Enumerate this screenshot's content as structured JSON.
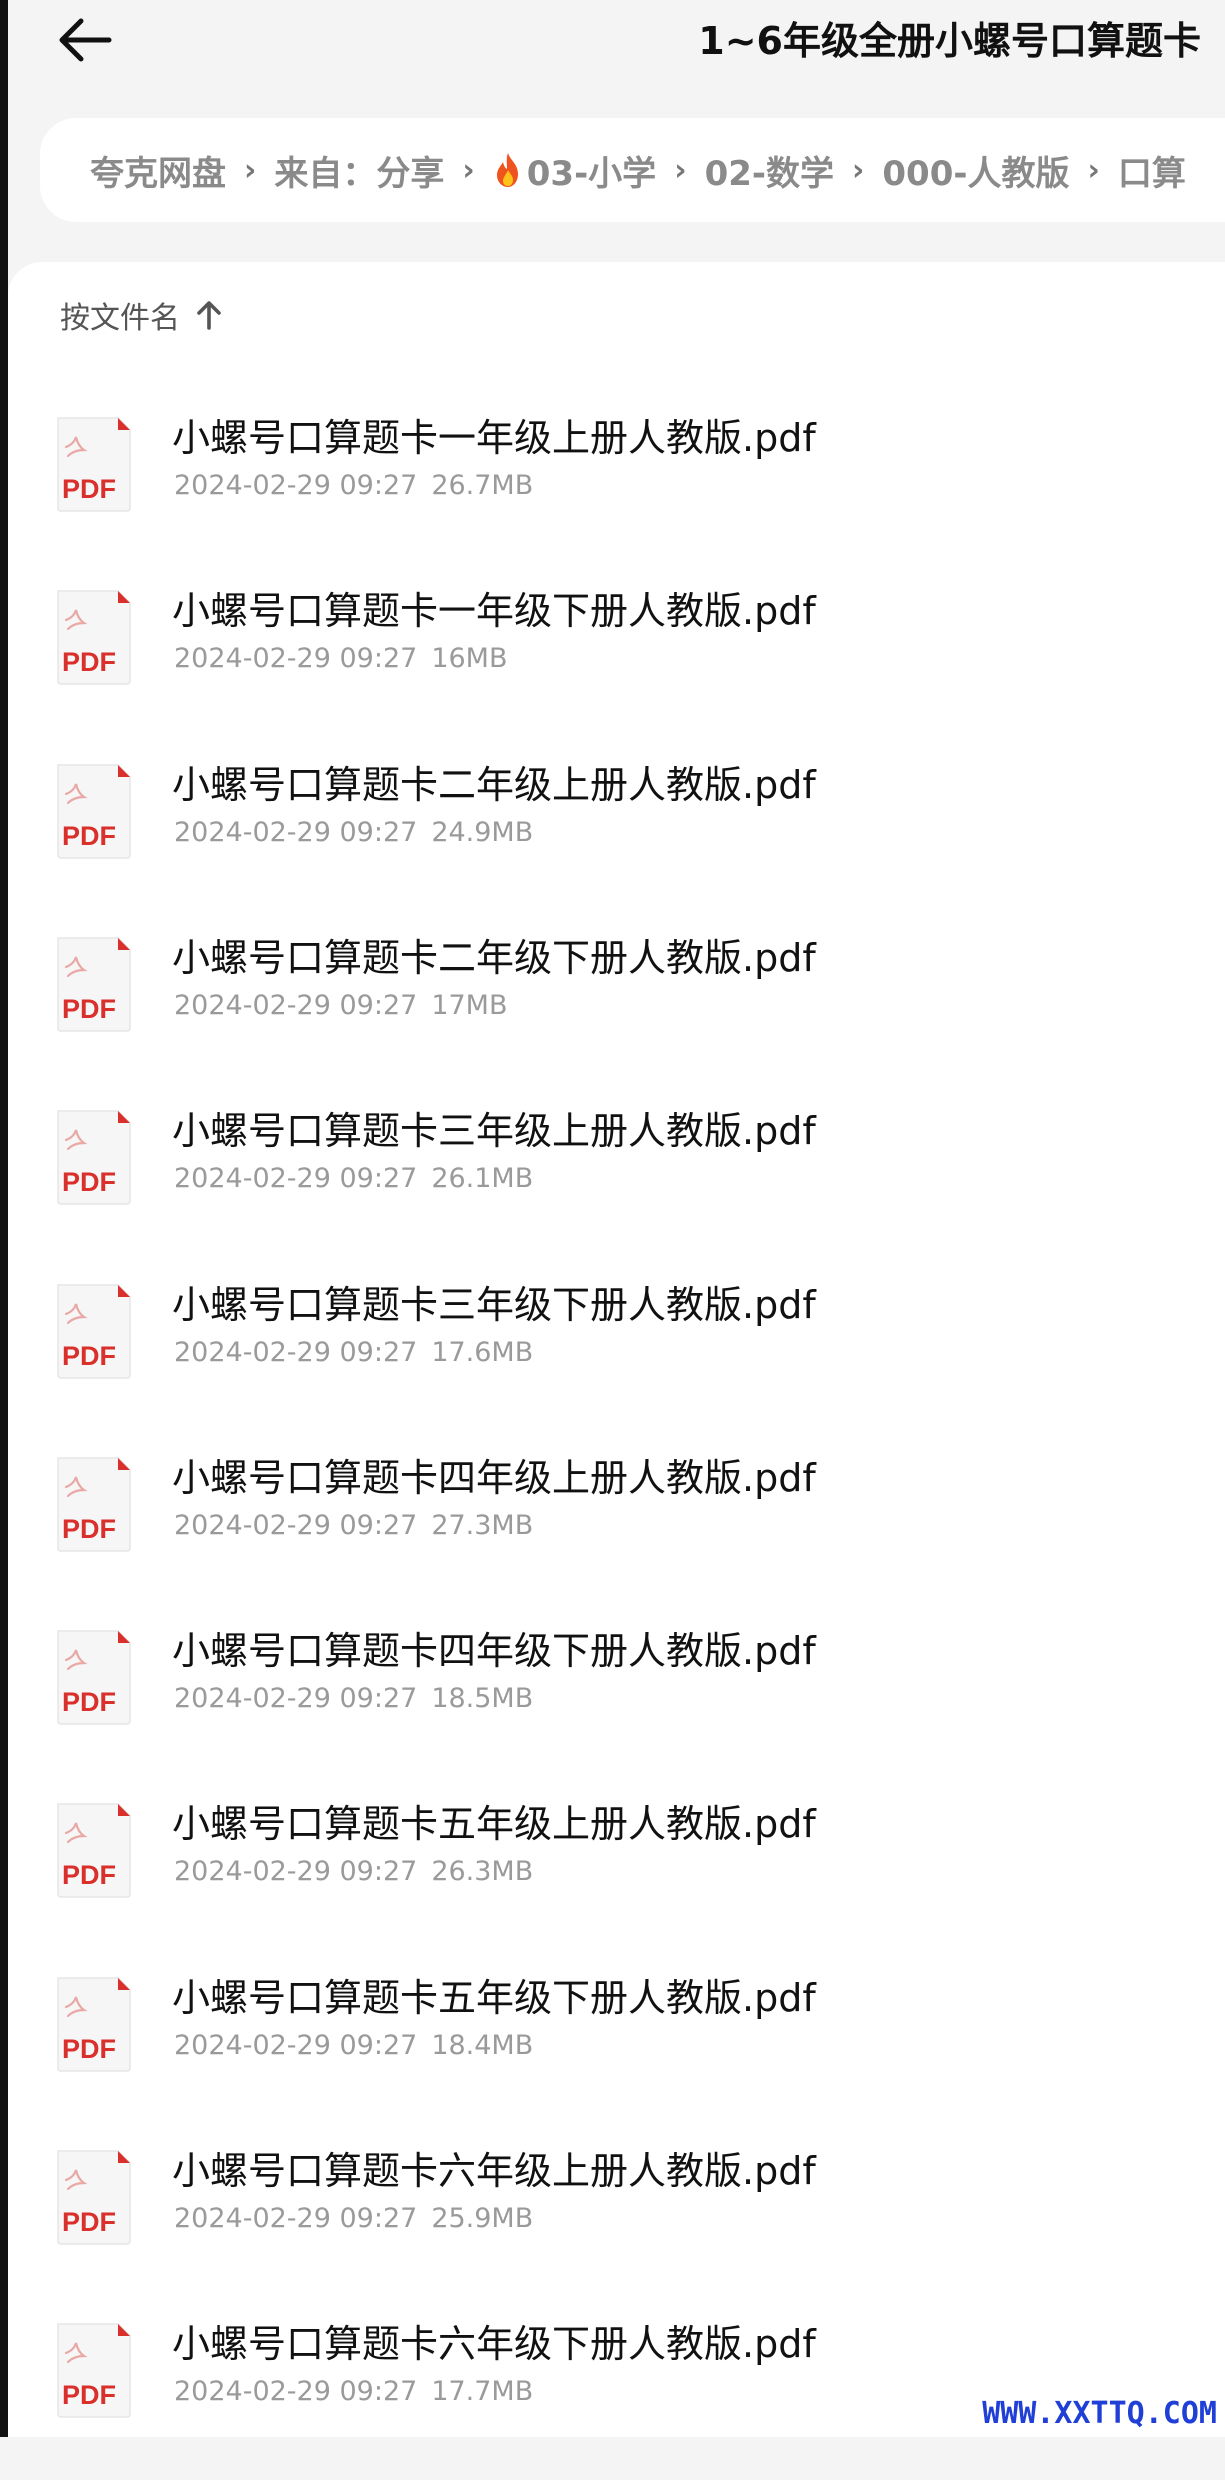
{
  "header": {
    "title": "1~6年级全册小螺号口算题卡",
    "back_icon": "arrow-left-icon"
  },
  "breadcrumb": {
    "items": [
      {
        "label": "夸克网盘"
      },
      {
        "label": "来自：分享"
      },
      {
        "label": "03-小学",
        "icon": "fire-icon"
      },
      {
        "label": "02-数学"
      },
      {
        "label": "000-人教版"
      },
      {
        "label": "口算"
      }
    ],
    "separator": "›"
  },
  "sort": {
    "label": "按文件名",
    "direction_icon": "arrow-up-icon"
  },
  "files": [
    {
      "name": "小螺号口算题卡一年级上册人教版.pdf",
      "date": "2024-02-29 09:27",
      "size": "26.7MB"
    },
    {
      "name": "小螺号口算题卡一年级下册人教版.pdf",
      "date": "2024-02-29 09:27",
      "size": "16MB"
    },
    {
      "name": "小螺号口算题卡二年级上册人教版.pdf",
      "date": "2024-02-29 09:27",
      "size": "24.9MB"
    },
    {
      "name": "小螺号口算题卡二年级下册人教版.pdf",
      "date": "2024-02-29 09:27",
      "size": "17MB"
    },
    {
      "name": "小螺号口算题卡三年级上册人教版.pdf",
      "date": "2024-02-29 09:27",
      "size": "26.1MB"
    },
    {
      "name": "小螺号口算题卡三年级下册人教版.pdf",
      "date": "2024-02-29 09:27",
      "size": "17.6MB"
    },
    {
      "name": "小螺号口算题卡四年级上册人教版.pdf",
      "date": "2024-02-29 09:27",
      "size": "27.3MB"
    },
    {
      "name": "小螺号口算题卡四年级下册人教版.pdf",
      "date": "2024-02-29 09:27",
      "size": "18.5MB"
    },
    {
      "name": "小螺号口算题卡五年级上册人教版.pdf",
      "date": "2024-02-29 09:27",
      "size": "26.3MB"
    },
    {
      "name": "小螺号口算题卡五年级下册人教版.pdf",
      "date": "2024-02-29 09:27",
      "size": "18.4MB"
    },
    {
      "name": "小螺号口算题卡六年级上册人教版.pdf",
      "date": "2024-02-29 09:27",
      "size": "25.9MB"
    },
    {
      "name": "小螺号口算题卡六年级下册人教版.pdf",
      "date": "2024-02-29 09:27",
      "size": "17.7MB"
    }
  ],
  "file_icon": {
    "name": "pdf-file-icon",
    "label": "PDF",
    "color": "#d9302c"
  },
  "watermark": "WWW.XXTTQ.COM",
  "colors": {
    "background": "#f4f4f4",
    "panel": "#ffffff",
    "meta_text": "#9a9a9a",
    "watermark": "#1f3fd6"
  }
}
